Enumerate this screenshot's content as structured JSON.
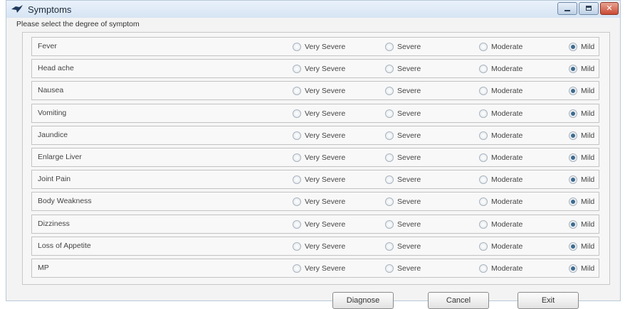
{
  "window": {
    "title": "Symptoms",
    "instruction": "Please select the degree of symptom"
  },
  "options": {
    "very_severe": "Very Severe",
    "severe": "Severe",
    "moderate": "Moderate",
    "mild": "Mild"
  },
  "symptoms": [
    {
      "label": "Fever",
      "selected": "mild"
    },
    {
      "label": "Head ache",
      "selected": "mild"
    },
    {
      "label": "Nausea",
      "selected": "mild"
    },
    {
      "label": "Vomiting",
      "selected": "mild"
    },
    {
      "label": "Jaundice",
      "selected": "mild"
    },
    {
      "label": "Enlarge Liver",
      "selected": "mild"
    },
    {
      "label": "Joint Pain",
      "selected": "mild"
    },
    {
      "label": "Body Weakness",
      "selected": "mild"
    },
    {
      "label": "Dizziness",
      "selected": "mild"
    },
    {
      "label": "Loss of Appetite",
      "selected": "mild"
    },
    {
      "label": "MP",
      "selected": "mild"
    }
  ],
  "buttons": {
    "diagnose": "Diagnose",
    "cancel": "Cancel",
    "exit": "Exit"
  },
  "colors": {
    "titlebar": "#d6e4f3",
    "close_button": "#c94a34",
    "radio_selected": "#3e6b8f"
  }
}
